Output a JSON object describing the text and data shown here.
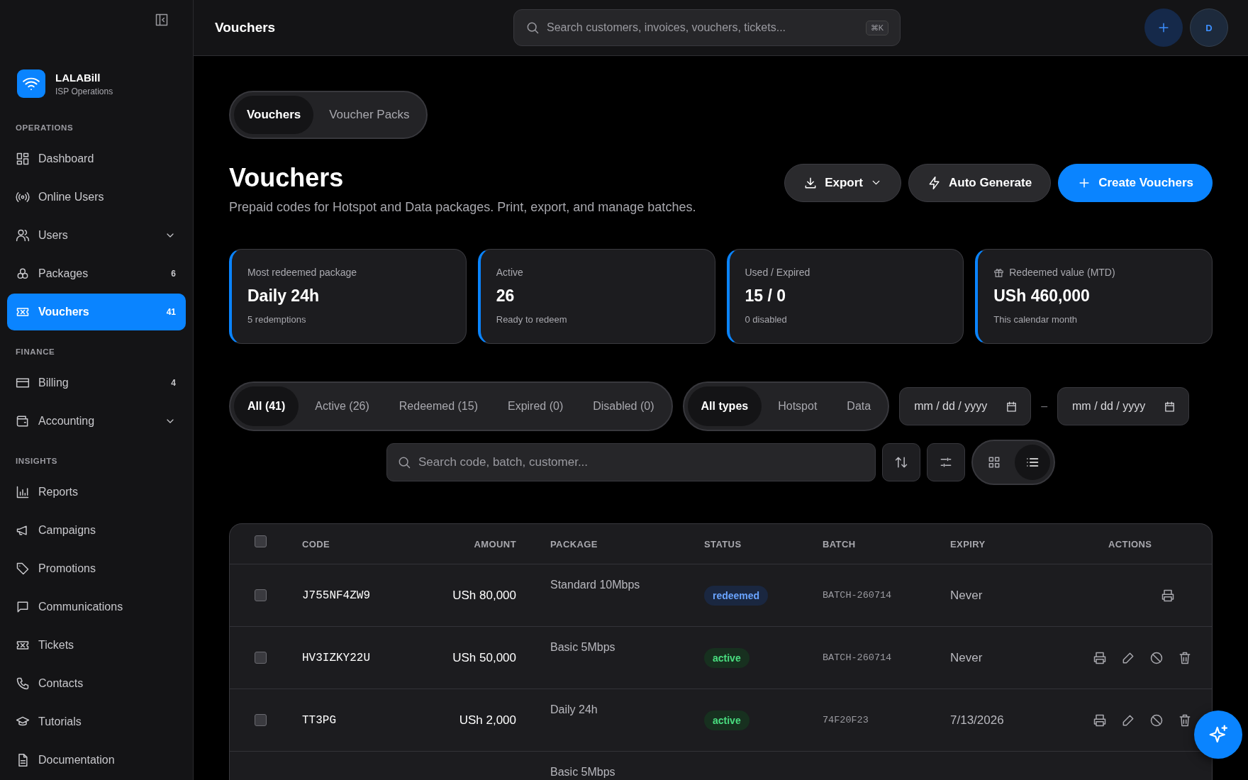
{
  "sidebar": {
    "brand": {
      "name": "LALABill",
      "subtitle": "ISP Operations"
    },
    "sections": [
      {
        "heading": "OPERATIONS",
        "items": [
          {
            "label": "Dashboard",
            "selected": false
          },
          {
            "label": "Online Users",
            "selected": false
          },
          {
            "label": "Users",
            "selected": false,
            "expandable": true
          },
          {
            "label": "Packages",
            "selected": false,
            "badge": "6"
          },
          {
            "label": "Vouchers",
            "selected": true,
            "badge": "41"
          }
        ]
      },
      {
        "heading": "FINANCE",
        "items": [
          {
            "label": "Billing",
            "selected": false,
            "badge": "4"
          },
          {
            "label": "Accounting",
            "selected": false,
            "expandable": true
          }
        ]
      },
      {
        "heading": "INSIGHTS",
        "items": [
          {
            "label": "Reports",
            "selected": false
          },
          {
            "label": "Campaigns",
            "selected": false
          },
          {
            "label": "Promotions",
            "selected": false
          },
          {
            "label": "Communications",
            "selected": false
          },
          {
            "label": "Tickets",
            "selected": false
          },
          {
            "label": "Contacts",
            "selected": false
          },
          {
            "label": "Tutorials",
            "selected": false
          },
          {
            "label": "Documentation",
            "selected": false
          }
        ]
      }
    ]
  },
  "topbar": {
    "title": "Vouchers",
    "search": {
      "placeholder": "Search customers, invoices, vouchers, tickets...",
      "shortcut": "⌘K"
    },
    "avatar": "D"
  },
  "tabs": [
    {
      "label": "Vouchers",
      "selected": true
    },
    {
      "label": "Voucher Packs",
      "selected": false
    }
  ],
  "header": {
    "title": "Vouchers",
    "subtitle": "Prepaid codes for Hotspot and Data packages. Print, export, and manage batches.",
    "actions": [
      {
        "kind": "export",
        "label": "Export"
      },
      {
        "kind": "generate",
        "label": "Auto Generate"
      },
      {
        "kind": "create",
        "label": "Create Vouchers"
      }
    ]
  },
  "stats": [
    {
      "label": "Most redeemed package",
      "value": "Daily 24h",
      "note": "5 redemptions"
    },
    {
      "label": "Active",
      "value": "26",
      "note": "Ready to redeem"
    },
    {
      "label": "Used / Expired",
      "value": "15 / 0",
      "note": "0 disabled"
    },
    {
      "label": "Redeemed value (MTD)",
      "value": "USh 460,000",
      "note": "This calendar month",
      "kind": "gift"
    }
  ],
  "status_filters": [
    {
      "label": "All (41)",
      "selected": true
    },
    {
      "label": "Active (26)",
      "selected": false
    },
    {
      "label": "Redeemed (15)",
      "selected": false
    },
    {
      "label": "Expired (0)",
      "selected": false
    },
    {
      "label": "Disabled (0)",
      "selected": false
    }
  ],
  "type_filters": [
    {
      "label": "All types",
      "selected": true
    },
    {
      "label": "Hotspot",
      "selected": false
    },
    {
      "label": "Data",
      "selected": false
    }
  ],
  "date_range": {
    "from": {
      "placeholder": "mm / dd / yyyy"
    },
    "separator": "–",
    "to": {
      "placeholder": "mm / dd / yyyy"
    }
  },
  "search": {
    "placeholder": "Search code, batch, customer..."
  },
  "view_modes": [
    {
      "kind": "grid",
      "selected": false
    },
    {
      "kind": "list",
      "selected": true
    }
  ],
  "table": {
    "select_all": {
      "checked": false
    },
    "columns": [
      "CODE",
      "AMOUNT",
      "PACKAGE",
      "STATUS",
      "BATCH",
      "EXPIRY",
      "ACTIONS"
    ],
    "rows": [
      {
        "checked": false,
        "code": "J755NF4ZW9",
        "amount": "USh 80,000",
        "package": "Standard 10Mbps",
        "status": {
          "label": "redeemed",
          "kind": "redeemed"
        },
        "batch": "BATCH-260714",
        "expiry": "Never",
        "actions": [
          {
            "kind": "print"
          }
        ]
      },
      {
        "checked": false,
        "code": "HV3IZKY22U",
        "amount": "USh 50,000",
        "package": "Basic 5Mbps",
        "status": {
          "label": "active",
          "kind": "active"
        },
        "batch": "BATCH-260714",
        "expiry": "Never",
        "actions": [
          {
            "kind": "print"
          },
          {
            "kind": "edit"
          },
          {
            "kind": "disable"
          },
          {
            "kind": "delete"
          }
        ]
      },
      {
        "checked": false,
        "code": "TT3PG",
        "amount": "USh 2,000",
        "package": "Daily 24h",
        "status": {
          "label": "active",
          "kind": "active"
        },
        "batch": "74F20F23",
        "expiry": "7/13/2026",
        "actions": [
          {
            "kind": "print"
          },
          {
            "kind": "edit"
          },
          {
            "kind": "disable"
          },
          {
            "kind": "delete"
          }
        ]
      },
      {
        "package": "Basic 5Mbps"
      }
    ]
  }
}
